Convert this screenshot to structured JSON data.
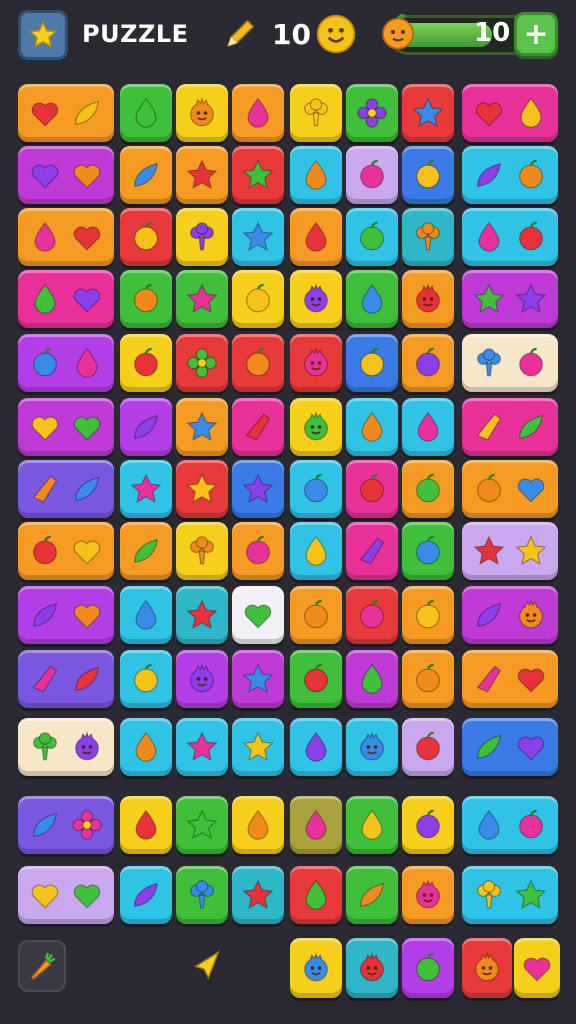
{
  "hud": {
    "title": "PUZZLE",
    "moves": "10",
    "energy": "10",
    "energy_level": 0.62,
    "add_label": "+"
  },
  "colors": {
    "orange": "#f59a23",
    "green": "#3fbf3a",
    "yellow": "#f5cf1a",
    "pink": "#e8329a",
    "purple": "#b43fe8",
    "cyan": "#2fc4e6",
    "red": "#e83a3a",
    "blue": "#3a7be8",
    "lavender": "#c9a8ef",
    "cream": "#f6e7c9",
    "white": "#f3f0f5",
    "olive": "#a8a23a",
    "violet": "#7a58e0",
    "teal": "#2fb7c9",
    "magenta": "#c03ad8",
    "lime": "#9bd23a"
  },
  "board": {
    "rows": [
      [
        {
          "c": "orange",
          "s": [
            "heart",
            "leaf"
          ],
          "w": 2
        },
        {
          "c": "green",
          "s": [
            "drop"
          ]
        },
        {
          "c": "yellow",
          "s": [
            "face"
          ]
        },
        {
          "c": "orange",
          "s": [
            "drop"
          ]
        },
        {
          "c": "yellow",
          "s": [
            "broccoli"
          ]
        },
        {
          "c": "green",
          "s": [
            "flower"
          ]
        },
        {
          "c": "red",
          "s": [
            "star"
          ]
        },
        {
          "c": "pink",
          "s": [
            "heart",
            "drop"
          ],
          "w": 2
        }
      ],
      [
        {
          "c": "magenta",
          "s": [
            "heart",
            "heart"
          ],
          "w": 2
        },
        {
          "c": "orange",
          "s": [
            "leaf"
          ]
        },
        {
          "c": "orange",
          "s": [
            "star"
          ]
        },
        {
          "c": "red",
          "s": [
            "star"
          ]
        },
        {
          "c": "cyan",
          "s": [
            "drop"
          ]
        },
        {
          "c": "lavender",
          "s": [
            "fruit"
          ]
        },
        {
          "c": "blue",
          "s": [
            "fruit"
          ]
        },
        {
          "c": "cyan",
          "s": [
            "leaf",
            "fruit"
          ],
          "w": 2
        }
      ],
      [
        {
          "c": "orange",
          "s": [
            "drop",
            "heart"
          ],
          "w": 2
        },
        {
          "c": "red",
          "s": [
            "fruit"
          ]
        },
        {
          "c": "yellow",
          "s": [
            "broccoli"
          ]
        },
        {
          "c": "cyan",
          "s": [
            "star"
          ]
        },
        {
          "c": "orange",
          "s": [
            "drop"
          ]
        },
        {
          "c": "cyan",
          "s": [
            "fruit"
          ]
        },
        {
          "c": "teal",
          "s": [
            "broccoli"
          ]
        },
        {
          "c": "cyan",
          "s": [
            "drop",
            "fruit"
          ],
          "w": 2
        }
      ],
      [
        {
          "c": "pink",
          "s": [
            "drop",
            "heart"
          ],
          "w": 2
        },
        {
          "c": "green",
          "s": [
            "fruit"
          ]
        },
        {
          "c": "green",
          "s": [
            "star"
          ]
        },
        {
          "c": "yellow",
          "s": [
            "fruit"
          ]
        },
        {
          "c": "yellow",
          "s": [
            "face"
          ]
        },
        {
          "c": "green",
          "s": [
            "drop"
          ]
        },
        {
          "c": "orange",
          "s": [
            "face"
          ]
        },
        {
          "c": "magenta",
          "s": [
            "star",
            "star"
          ],
          "w": 2
        }
      ],
      [
        {
          "c": "purple",
          "s": [
            "fruit",
            "drop"
          ],
          "w": 2
        },
        {
          "c": "yellow",
          "s": [
            "fruit"
          ]
        },
        {
          "c": "red",
          "s": [
            "flower"
          ]
        },
        {
          "c": "red",
          "s": [
            "fruit"
          ]
        },
        {
          "c": "red",
          "s": [
            "face"
          ]
        },
        {
          "c": "blue",
          "s": [
            "fruit"
          ]
        },
        {
          "c": "orange",
          "s": [
            "fruit"
          ]
        },
        {
          "c": "cream",
          "s": [
            "broccoli",
            "fruit"
          ],
          "w": 2
        }
      ],
      [
        {
          "c": "magenta",
          "s": [
            "heart",
            "heart"
          ],
          "w": 2
        },
        {
          "c": "purple",
          "s": [
            "leaf"
          ]
        },
        {
          "c": "orange",
          "s": [
            "star"
          ]
        },
        {
          "c": "pink",
          "s": [
            "shard"
          ]
        },
        {
          "c": "yellow",
          "s": [
            "face"
          ]
        },
        {
          "c": "cyan",
          "s": [
            "drop"
          ]
        },
        {
          "c": "cyan",
          "s": [
            "drop"
          ]
        },
        {
          "c": "pink",
          "s": [
            "shard",
            "leaf"
          ],
          "w": 2
        }
      ],
      [
        {
          "c": "violet",
          "s": [
            "shard",
            "leaf"
          ],
          "w": 2
        },
        {
          "c": "cyan",
          "s": [
            "star"
          ]
        },
        {
          "c": "red",
          "s": [
            "star"
          ]
        },
        {
          "c": "blue",
          "s": [
            "star"
          ]
        },
        {
          "c": "cyan",
          "s": [
            "fruit"
          ]
        },
        {
          "c": "pink",
          "s": [
            "fruit"
          ]
        },
        {
          "c": "orange",
          "s": [
            "fruit"
          ]
        },
        {
          "c": "orange",
          "s": [
            "fruit",
            "heart"
          ],
          "w": 2
        }
      ],
      [
        {
          "c": "orange",
          "s": [
            "fruit",
            "heart"
          ],
          "w": 2
        },
        {
          "c": "orange",
          "s": [
            "leaf"
          ]
        },
        {
          "c": "yellow",
          "s": [
            "broccoli"
          ]
        },
        {
          "c": "orange",
          "s": [
            "fruit"
          ]
        },
        {
          "c": "cyan",
          "s": [
            "drop"
          ]
        },
        {
          "c": "pink",
          "s": [
            "shard"
          ]
        },
        {
          "c": "green",
          "s": [
            "fruit"
          ]
        },
        {
          "c": "lavender",
          "s": [
            "star",
            "star"
          ],
          "w": 2
        }
      ],
      [
        {
          "c": "purple",
          "s": [
            "leaf",
            "heart"
          ],
          "w": 2
        },
        {
          "c": "cyan",
          "s": [
            "drop"
          ]
        },
        {
          "c": "teal",
          "s": [
            "star"
          ]
        },
        {
          "c": "white",
          "s": [
            "heart"
          ]
        },
        {
          "c": "orange",
          "s": [
            "fruit"
          ]
        },
        {
          "c": "red",
          "s": [
            "fruit"
          ]
        },
        {
          "c": "orange",
          "s": [
            "fruit"
          ]
        },
        {
          "c": "magenta",
          "s": [
            "leaf",
            "face"
          ],
          "w": 2
        }
      ],
      [
        {
          "c": "violet",
          "s": [
            "shard",
            "leaf"
          ],
          "w": 2
        },
        {
          "c": "cyan",
          "s": [
            "fruit"
          ]
        },
        {
          "c": "purple",
          "s": [
            "face"
          ]
        },
        {
          "c": "magenta",
          "s": [
            "star"
          ]
        },
        {
          "c": "green",
          "s": [
            "fruit"
          ]
        },
        {
          "c": "magenta",
          "s": [
            "drop"
          ]
        },
        {
          "c": "orange",
          "s": [
            "fruit"
          ]
        },
        {
          "c": "orange",
          "s": [
            "shard",
            "heart"
          ],
          "w": 2
        }
      ],
      [
        {
          "c": "cream",
          "s": [
            "broccoli",
            "face"
          ],
          "w": 2
        },
        {
          "c": "cyan",
          "s": [
            "drop"
          ]
        },
        {
          "c": "cyan",
          "s": [
            "star"
          ]
        },
        {
          "c": "cyan",
          "s": [
            "star"
          ]
        },
        {
          "c": "cyan",
          "s": [
            "drop"
          ]
        },
        {
          "c": "cyan",
          "s": [
            "face"
          ]
        },
        {
          "c": "lavender",
          "s": [
            "fruit"
          ]
        },
        {
          "c": "blue",
          "s": [
            "leaf",
            "heart"
          ],
          "w": 2
        }
      ],
      [
        {
          "c": "violet",
          "s": [
            "leaf",
            "flower"
          ],
          "w": 2
        },
        {
          "c": "yellow",
          "s": [
            "drop"
          ]
        },
        {
          "c": "green",
          "s": [
            "star"
          ]
        },
        {
          "c": "yellow",
          "s": [
            "drop"
          ]
        },
        {
          "c": "olive",
          "s": [
            "drop"
          ]
        },
        {
          "c": "green",
          "s": [
            "drop"
          ]
        },
        {
          "c": "yellow",
          "s": [
            "fruit"
          ]
        },
        {
          "c": "cyan",
          "s": [
            "drop",
            "fruit"
          ],
          "w": 2
        }
      ],
      [
        {
          "c": "lavender",
          "s": [
            "heart",
            "heart"
          ],
          "w": 2
        },
        {
          "c": "cyan",
          "s": [
            "leaf"
          ]
        },
        {
          "c": "green",
          "s": [
            "broccoli"
          ]
        },
        {
          "c": "teal",
          "s": [
            "star"
          ]
        },
        {
          "c": "red",
          "s": [
            "drop"
          ]
        },
        {
          "c": "green",
          "s": [
            "leaf"
          ]
        },
        {
          "c": "orange",
          "s": [
            "face"
          ]
        },
        {
          "c": "cyan",
          "s": [
            "broccoli",
            "star"
          ],
          "w": 2
        }
      ],
      [
        null,
        null,
        null,
        null,
        {
          "c": "yellow",
          "s": [
            "face"
          ]
        },
        {
          "c": "teal",
          "s": [
            "face"
          ]
        },
        {
          "c": "purple",
          "s": [
            "fruit"
          ]
        },
        {
          "c": "red",
          "s": [
            "face"
          ]
        },
        {
          "c": "yellow",
          "s": [
            "heart"
          ]
        }
      ]
    ]
  }
}
